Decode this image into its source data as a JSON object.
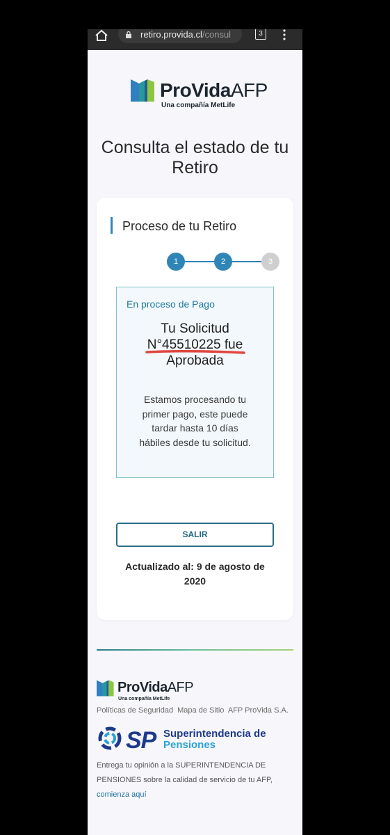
{
  "browser": {
    "url_main": "retiro.provida.cl",
    "url_dim": "/consul",
    "tab_count": "3"
  },
  "brand": {
    "name": "ProVida",
    "suffix": "AFP",
    "tagline": "Una compañía MetLife",
    "colors": {
      "primary": "#2f86b6",
      "dark": "#1c2630"
    }
  },
  "page": {
    "title_line1": "Consulta el estado de tu",
    "title_line2": "Retiro"
  },
  "process": {
    "heading": "Proceso de tu Retiro",
    "steps": [
      {
        "label": "1",
        "state": "done"
      },
      {
        "label": "2",
        "state": "current"
      },
      {
        "label": "3",
        "state": "pending"
      }
    ],
    "status_label": "En proceso de Pago",
    "message_line1": "Tu Solicitud",
    "message_line2": "N°45510225 fue",
    "message_line3": "Aprobada",
    "body_line1": "Estamos procesando tu",
    "body_line2": "primer pago, este puede",
    "body_line3": "tardar hasta 10 días",
    "body_line4": "hábiles desde tu solicitud."
  },
  "actions": {
    "exit_label": "SALIR"
  },
  "updated": {
    "line1": "Actualizado al: 9 de agosto de",
    "line2": "2020"
  },
  "footer": {
    "links": [
      "Políticas de Seguridad",
      "Mapa de Sitio",
      "AFP ProVida S.A."
    ],
    "sp_letters": "SP",
    "sp_name_line1": "Superintendencia de",
    "sp_name_line2": "Pensiones",
    "feedback_text": "Entrega tu opinión a la SUPERINTENDENCIA DE PENSIONES sobre la calidad de servicio de tu AFP,",
    "feedback_link": "comienza aquí"
  }
}
